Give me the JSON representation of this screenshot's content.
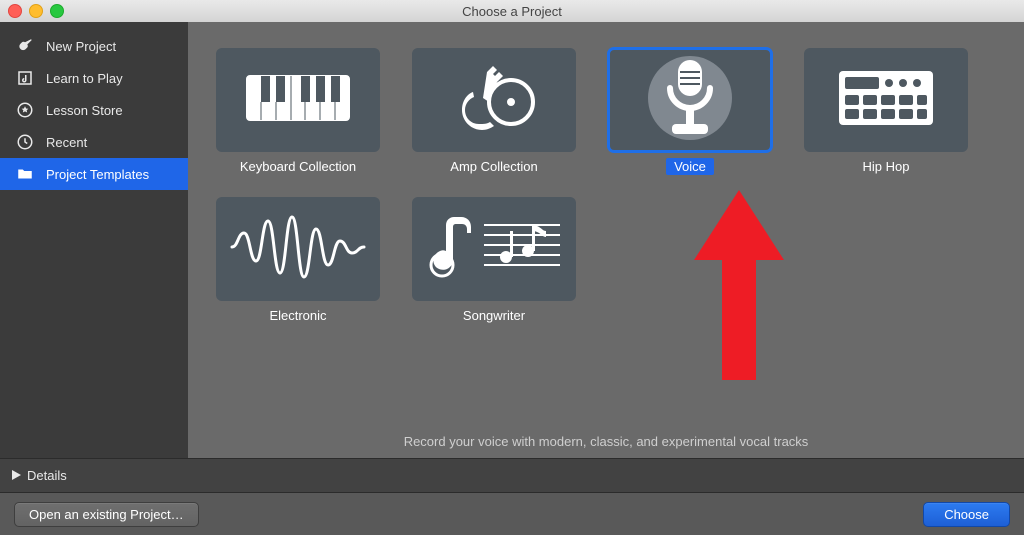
{
  "window": {
    "title": "Choose a Project"
  },
  "sidebar": {
    "items": [
      {
        "label": "New Project"
      },
      {
        "label": "Learn to Play"
      },
      {
        "label": "Lesson Store"
      },
      {
        "label": "Recent"
      },
      {
        "label": "Project Templates"
      }
    ]
  },
  "templates": [
    {
      "label": "Keyboard Collection"
    },
    {
      "label": "Amp Collection"
    },
    {
      "label": "Voice"
    },
    {
      "label": "Hip Hop"
    },
    {
      "label": "Electronic"
    },
    {
      "label": "Songwriter"
    }
  ],
  "description": "Record your voice with modern, classic, and experimental vocal tracks",
  "details": {
    "label": "Details"
  },
  "buttons": {
    "open": "Open an existing Project…",
    "choose": "Choose"
  }
}
